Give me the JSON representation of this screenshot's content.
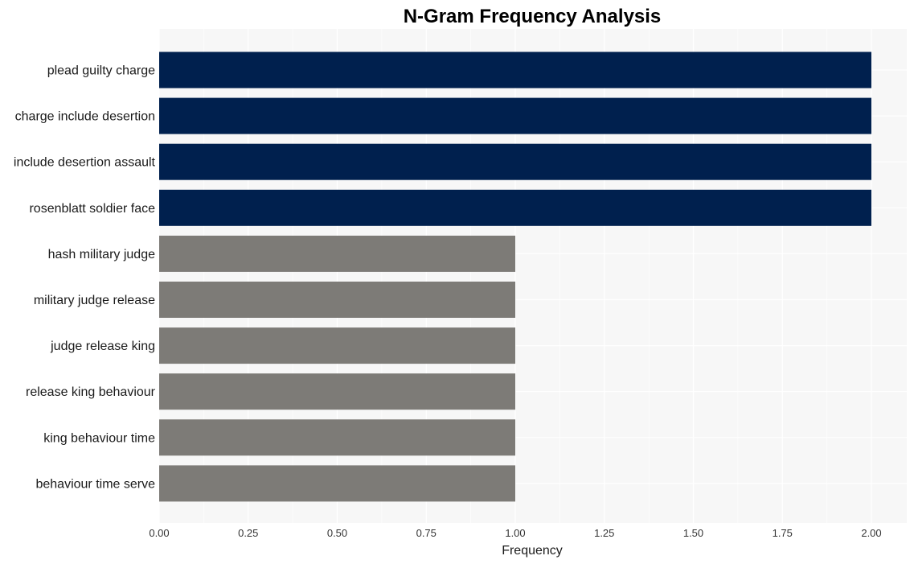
{
  "chart_data": {
    "type": "bar",
    "orientation": "horizontal",
    "title": "N-Gram Frequency Analysis",
    "xlabel": "Frequency",
    "ylabel": "",
    "xlim": [
      0,
      2.0
    ],
    "xticks": [
      "0.00",
      "0.25",
      "0.50",
      "0.75",
      "1.00",
      "1.25",
      "1.50",
      "1.75",
      "2.00"
    ],
    "grid": true,
    "categories": [
      "plead guilty charge",
      "charge include desertion",
      "include desertion assault",
      "rosenblatt soldier face",
      "hash military judge",
      "military judge release",
      "judge release king",
      "release king behaviour",
      "king behaviour time",
      "behaviour time serve"
    ],
    "values": [
      2,
      2,
      2,
      2,
      1,
      1,
      1,
      1,
      1,
      1
    ],
    "colors": {
      "high": "#00204e",
      "low": "#7d7b77",
      "panel": "#f7f7f7",
      "grid": "#ffffff"
    }
  }
}
